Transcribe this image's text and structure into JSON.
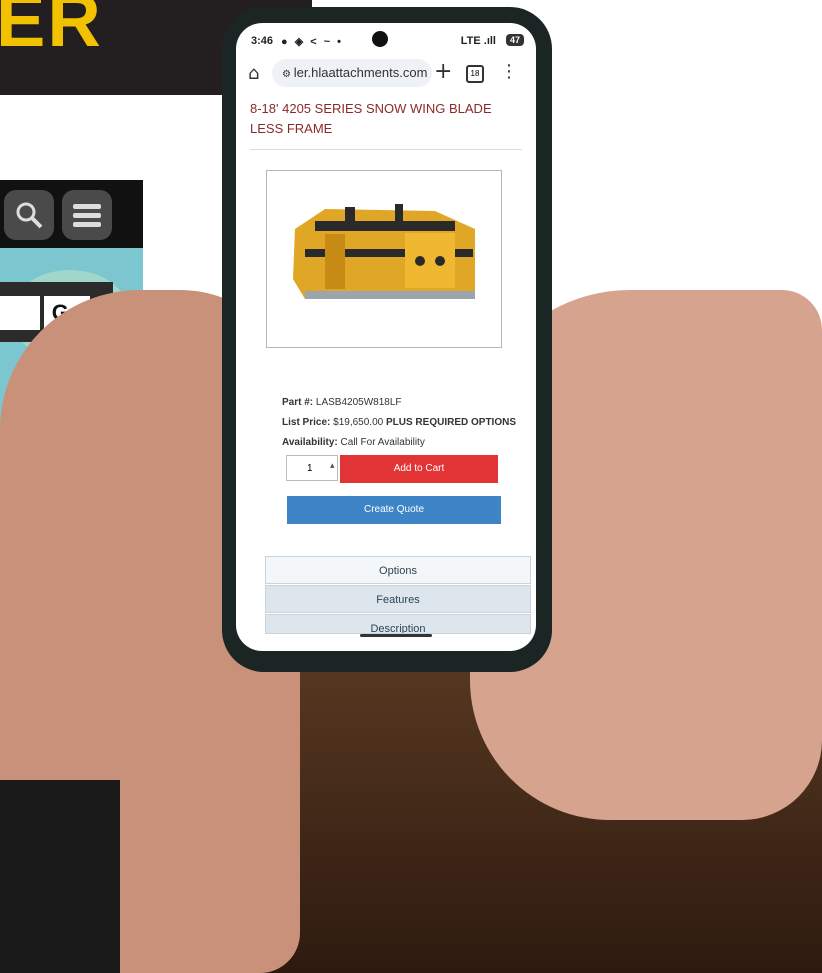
{
  "background": {
    "banner_text": "ER",
    "go_label": "Go"
  },
  "phone": {
    "status": {
      "time": "3:46",
      "icons": "● ◈ < ~ •",
      "network": "LTE",
      "signal": ".ıll",
      "battery": "47"
    },
    "browser": {
      "url": "ler.hlaattachments.com",
      "tabs_count": "18"
    },
    "product": {
      "title": "8-18' 4205 SERIES SNOW WING BLADE LESS FRAME",
      "part_label": "Part #:",
      "part_number": "LASB4205W818LF",
      "list_price_label": "List Price:",
      "list_price": "$19,650.00",
      "price_note": "PLUS REQUIRED OPTIONS",
      "availability_label": "Availability:",
      "availability": "Call For Availability",
      "quantity": "1",
      "add_to_cart_label": "Add to Cart",
      "create_quote_label": "Create Quote"
    },
    "tabs": [
      "Options",
      "Features",
      "Description"
    ]
  },
  "colors": {
    "accent_red": "#e23434",
    "accent_blue": "#3d85c6",
    "title_color": "#8a2a28",
    "banner_yellow": "#f2c200"
  }
}
